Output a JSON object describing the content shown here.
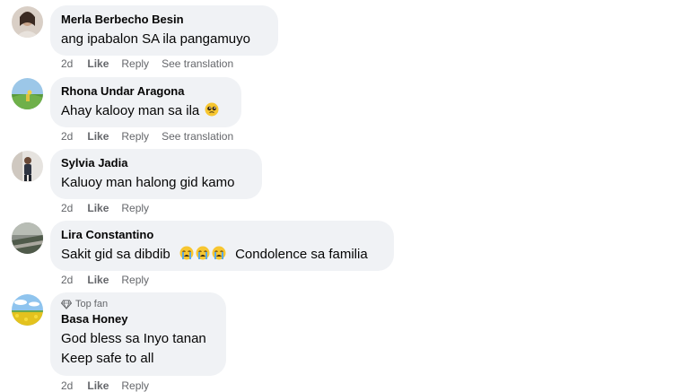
{
  "comments": [
    {
      "name": "Merla Berbecho Besin",
      "text": "ang ipabalon SA ila pangamuyo",
      "time": "2d",
      "like": "Like",
      "reply": "Reply",
      "translate": "See translation"
    },
    {
      "name": "Rhona Undar Aragona",
      "text": "Ahay kalooy man sa ila",
      "emoji": "pleading-face-icon",
      "time": "2d",
      "like": "Like",
      "reply": "Reply",
      "translate": "See translation"
    },
    {
      "name": "Sylvia Jadia",
      "text": "Kaluoy man halong gid kamo",
      "time": "2d",
      "like": "Like",
      "reply": "Reply"
    },
    {
      "name": "Lira Constantino",
      "text_before": "Sakit gid sa dibdib",
      "text_after": "Condolence sa familia",
      "emoji": "loudly-crying-face-icon",
      "time": "2d",
      "like": "Like",
      "reply": "Reply"
    },
    {
      "badge": "Top fan",
      "badge_icon": "diamond-icon",
      "name": "Basa Honey",
      "line1": "God bless sa Inyo tanan",
      "line2": "Keep safe to all",
      "time": "2d",
      "like": "Like",
      "reply": "Reply"
    }
  ],
  "colors": {
    "bubble": "#f0f2f5",
    "secondary_text": "#65676b",
    "primary_text": "#050505"
  }
}
